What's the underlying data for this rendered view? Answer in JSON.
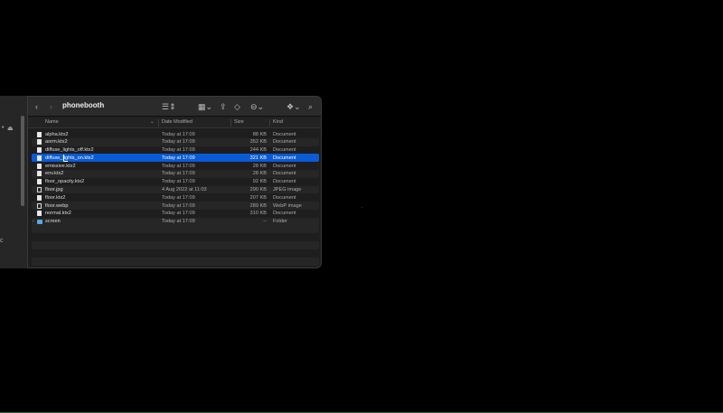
{
  "window": {
    "title": "phonebooth",
    "icons": {
      "back": "chevron-left-icon",
      "forward": "chevron-right-icon",
      "view_list": "list-view-icon",
      "view_grid": "grid-view-icon",
      "share": "share-icon",
      "tag": "tag-icon",
      "more": "ellipsis-icon",
      "dropbox": "dropbox-icon",
      "search": "search-icon"
    }
  },
  "columns": {
    "name": "Name",
    "date": "Date Modified",
    "size": "Size",
    "kind": "Kind"
  },
  "files": [
    {
      "name": "alpha.ktx2",
      "date": "Today at 17:09",
      "size": "88 KB",
      "kind": "Document",
      "icon": "doc"
    },
    {
      "name": "aorm.ktx2",
      "date": "Today at 17:09",
      "size": "352 KB",
      "kind": "Document",
      "icon": "doc"
    },
    {
      "name": "diffuse_lights_off.ktx2",
      "date": "Today at 17:09",
      "size": "244 KB",
      "kind": "Document",
      "icon": "doc"
    },
    {
      "name": "diffuse_lights_on.ktx2",
      "date": "Today at 17:09",
      "size": "321 KB",
      "kind": "Document",
      "icon": "doc",
      "selected": true
    },
    {
      "name": "emissive.ktx2",
      "date": "Today at 17:09",
      "size": "28 KB",
      "kind": "Document",
      "icon": "doc"
    },
    {
      "name": "env.ktx2",
      "date": "Today at 17:09",
      "size": "28 KB",
      "kind": "Document",
      "icon": "doc"
    },
    {
      "name": "floor_opacity.ktx2",
      "date": "Today at 17:09",
      "size": "92 KB",
      "kind": "Document",
      "icon": "doc"
    },
    {
      "name": "floor.jpg",
      "date": "4 Aug 2022 at 11:03",
      "size": "290 KB",
      "kind": "JPEG image",
      "icon": "img"
    },
    {
      "name": "floor.ktx2",
      "date": "Today at 17:09",
      "size": "207 KB",
      "kind": "Document",
      "icon": "doc"
    },
    {
      "name": "floor.webp",
      "date": "Today at 17:09",
      "size": "289 KB",
      "kind": "WebP image",
      "icon": "img"
    },
    {
      "name": "normal.ktx2",
      "date": "Today at 17:09",
      "size": "310 KB",
      "kind": "Document",
      "icon": "doc"
    },
    {
      "name": "screen",
      "date": "Today at 17:09",
      "size": "--",
      "kind": "Folder",
      "icon": "folder"
    }
  ],
  "colors": {
    "selection": "#0a5bd6",
    "folder": "#5aa6e6"
  }
}
